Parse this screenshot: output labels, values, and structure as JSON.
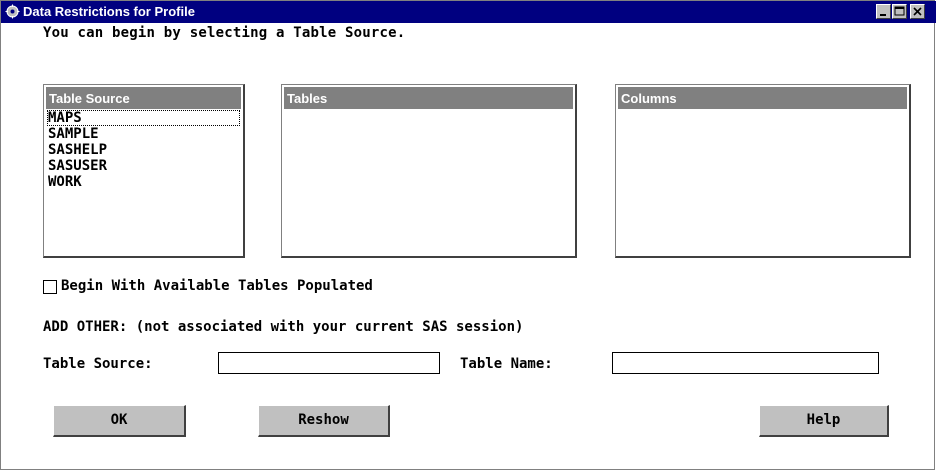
{
  "window": {
    "title": "Data Restrictions for Profile",
    "icon": "sas-window-icon",
    "controls": [
      "minimize-icon",
      "maximize-icon",
      "close-icon"
    ]
  },
  "instruction": "You can begin by selecting a Table Source.",
  "lists": {
    "table_source": {
      "header": "Table Source",
      "items": [
        "MAPS",
        "SAMPLE",
        "SASHELP",
        "SASUSER",
        "WORK"
      ],
      "focused_item": "MAPS"
    },
    "tables": {
      "header": "Tables",
      "items": []
    },
    "columns": {
      "header": "Columns",
      "items": []
    }
  },
  "checkbox": {
    "label": "Begin With Available Tables Populated",
    "checked": false
  },
  "add_other": "ADD OTHER: (not associated with your current SAS session)",
  "fields": {
    "table_source_label": "Table Source:",
    "table_source_value": "",
    "table_name_label": "Table Name:",
    "table_name_value": ""
  },
  "buttons": {
    "ok": "OK",
    "reshow": "Reshow",
    "help": "Help"
  },
  "colors": {
    "titlebar": "#000080",
    "list_header": "#808080",
    "button_face": "#c0c0c0"
  }
}
